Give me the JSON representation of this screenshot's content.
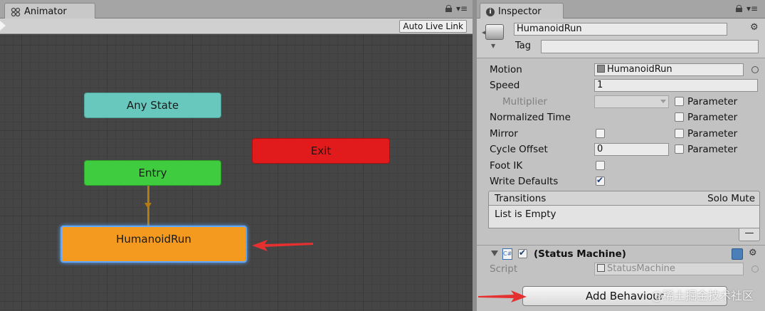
{
  "animator": {
    "tab_label": "Animator",
    "auto_live_link": "Auto Live Link",
    "states": {
      "any_state": "Any State",
      "entry": "Entry",
      "exit": "Exit",
      "humanoid_run": "HumanoidRun"
    }
  },
  "inspector": {
    "tab_label": "Inspector",
    "object_name": "HumanoidRun",
    "tag_label": "Tag",
    "tag_value": "",
    "properties": {
      "motion_label": "Motion",
      "motion_value": "HumanoidRun",
      "speed_label": "Speed",
      "speed_value": "1",
      "multiplier_label": "Multiplier",
      "normalized_time_label": "Normalized Time",
      "mirror_label": "Mirror",
      "cycle_offset_label": "Cycle Offset",
      "cycle_offset_value": "0",
      "foot_ik_label": "Foot IK",
      "write_defaults_label": "Write Defaults",
      "parameter_label": "Parameter"
    },
    "transitions": {
      "header": "Transitions",
      "solo_mute": "Solo Mute",
      "empty_text": "List is Empty",
      "minus": "—"
    },
    "behaviour": {
      "title": "(Status Machine)",
      "script_label": "Script",
      "script_value": "StatusMachine"
    },
    "add_behaviour": "Add Behaviour"
  },
  "watermark": "@稀土掘金技术社区",
  "colors": {
    "any_state": "#69c8bd",
    "entry": "#3fcd3f",
    "exit": "#e11b1b",
    "default_state": "#f39a1f",
    "annotation_arrow": "#e53030"
  }
}
